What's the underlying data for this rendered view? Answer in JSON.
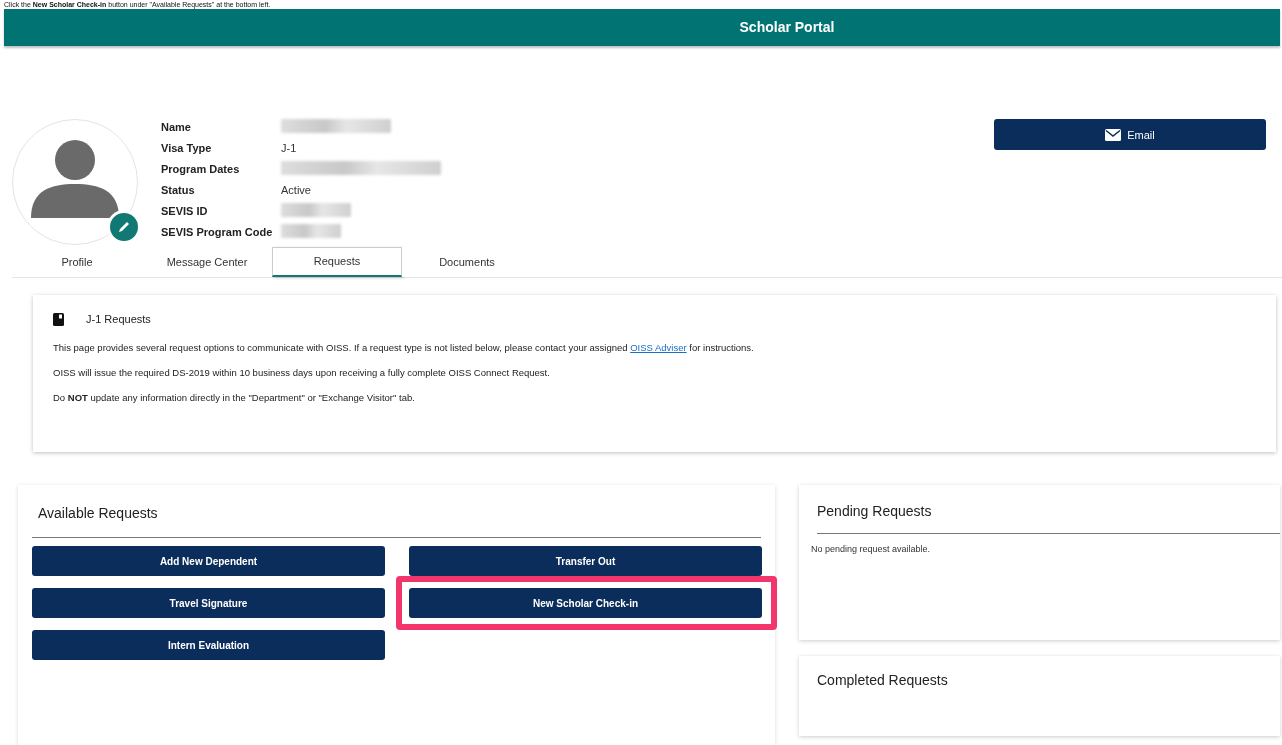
{
  "caption": "Click the **New Scholar Check-in** button under \"Available Requests\" at the bottom left.",
  "header": {
    "title": "Scholar Portal"
  },
  "profile": {
    "fields": [
      {
        "label": "Name",
        "redacted": true
      },
      {
        "label": "Visa Type",
        "value": "J-1",
        "redacted": false
      },
      {
        "label": "Program Dates",
        "redacted": true
      },
      {
        "label": "Status",
        "value": "Active",
        "redacted": false
      },
      {
        "label": "SEVIS ID",
        "redacted": true
      },
      {
        "label": "SEVIS Program Code",
        "redacted": true
      }
    ],
    "email_button": "Email"
  },
  "tabs": [
    {
      "label": "Profile",
      "selected": false
    },
    {
      "label": "Message Center",
      "selected": false
    },
    {
      "label": "Requests",
      "selected": true
    },
    {
      "label": "Documents",
      "selected": false
    }
  ],
  "info": {
    "title": "J-1 Requests",
    "paragraphs": [
      {
        "before": "This page provides several request options to communicate with OISS.  If a request type is not listed below, please contact your assigned ",
        "link": "OISS Adviser",
        "after": " for instructions."
      },
      {
        "before": "OISS will issue the required DS-2019 within 10 business days upon receiving a fully complete OISS Connect Request."
      },
      {
        "before": "Do **NOT** update any information directly in the \"Department\" or \"Exchange Visitor\" tab."
      }
    ]
  },
  "available_requests": {
    "title": "Available Requests",
    "buttons": [
      {
        "label": "Add New Dependent",
        "highlighted": false
      },
      {
        "label": "Transfer Out",
        "highlighted": false
      },
      {
        "label": "Travel Signature",
        "highlighted": false
      },
      {
        "label": "New Scholar Check-in",
        "highlighted": true
      },
      {
        "label": "Intern Evaluation",
        "highlighted": false
      }
    ]
  },
  "pending_requests": {
    "title": "Pending Requests",
    "empty_text": "No pending request available."
  },
  "completed_requests": {
    "title": "Completed Requests"
  }
}
